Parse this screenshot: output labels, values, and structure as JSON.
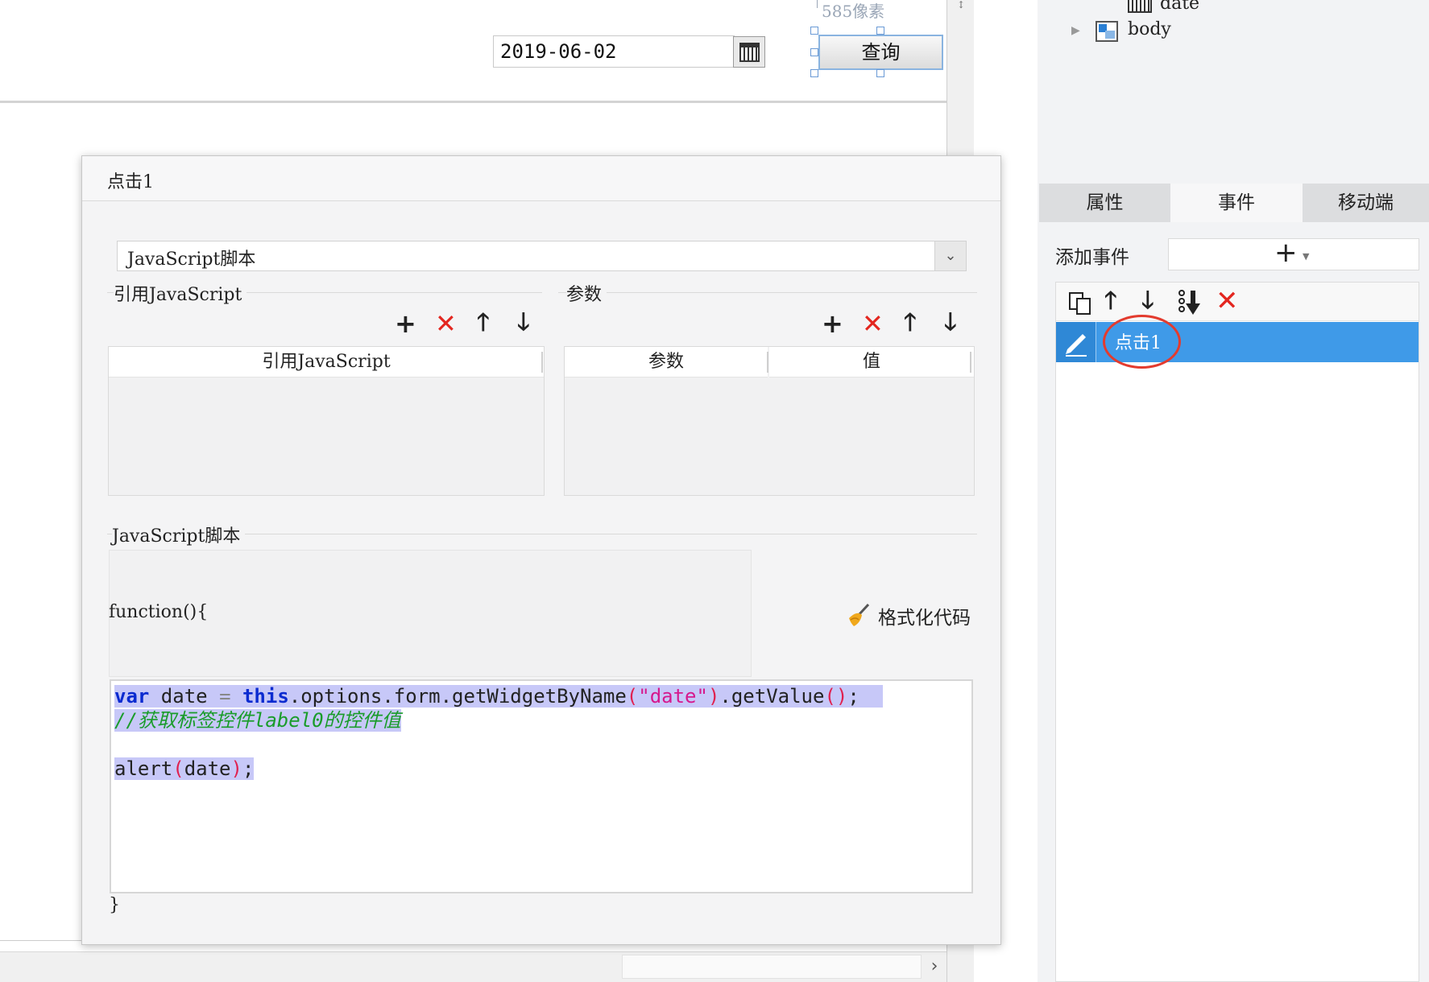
{
  "canvas": {
    "pixel_label": "585像素",
    "date_value": "2019-06-02",
    "query_button": "查询"
  },
  "tree": {
    "date_label": "date",
    "body_label": "body"
  },
  "right_panel": {
    "tabs": [
      {
        "label": "属性"
      },
      {
        "label": "事件"
      },
      {
        "label": "移动端"
      }
    ],
    "add_event_label": "添加事件",
    "add_event_plus": "+",
    "events": [
      {
        "label": "点击1"
      }
    ]
  },
  "dialog": {
    "title": "点击1",
    "type_select": "JavaScript脚本",
    "ref_js_section": "引用JavaScript",
    "ref_js_column": "引用JavaScript",
    "params_section": "参数",
    "params_columns": [
      "参数",
      "值"
    ],
    "script_section": "JavaScript脚本",
    "fn_open": "function(){",
    "fn_close": "}",
    "format_code": "格式化代码",
    "code": {
      "line1": {
        "kw_var": "var",
        "ident_date": " date ",
        "eq": "=",
        "kw_this": "this",
        "call": ".options.form.getWidgetByName",
        "lparen": "(",
        "string": "\"date\"",
        "rparen": ")",
        "getvalue": ".getValue",
        "empty_parens": "()",
        "semi": ";"
      },
      "line2": "//获取标签控件label0的控件值",
      "line4": {
        "alert": "alert",
        "lparen": "(",
        "arg": "date",
        "rparen": ")",
        "semi": ";"
      }
    }
  },
  "colors": {
    "selection": "#c7c8f8",
    "keyword": "#0b2bd0",
    "string": "#d6188e",
    "comment": "#1a9c2a",
    "accent_row": "#3f9ae8",
    "delete_red": "#e3261f",
    "annotation_circle": "#e33b2e"
  }
}
